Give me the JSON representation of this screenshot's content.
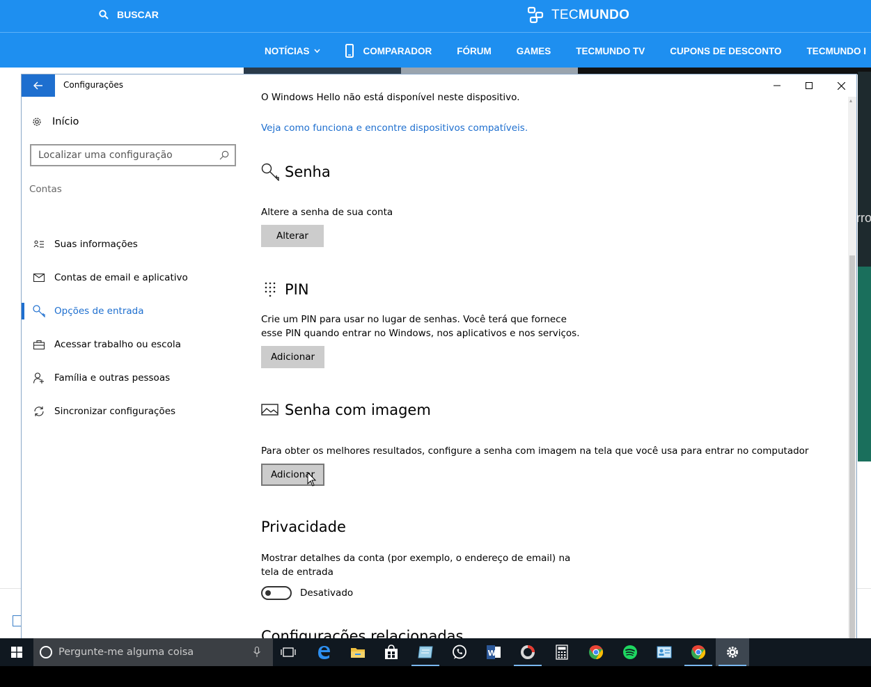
{
  "site": {
    "search_label": "BUSCAR",
    "brand_light": "TEC",
    "brand_bold": "MUNDO",
    "nav": [
      "NOTÍCIAS",
      "COMPARADOR",
      "FÓRUM",
      "GAMES",
      "TECMUNDO TV",
      "CUPONS DE DESCONTO",
      "TECMUNDO I"
    ],
    "bg_text": "rro"
  },
  "window": {
    "title": "Configurações"
  },
  "sidebar": {
    "home_label": "Início",
    "search_placeholder": "Localizar uma configuração",
    "section_label": "Contas",
    "items": [
      {
        "label": "Suas informações",
        "icon": "person-card-icon"
      },
      {
        "label": "Contas de email e aplicativo",
        "icon": "mail-icon"
      },
      {
        "label": "Opções de entrada",
        "icon": "key-icon",
        "active": true
      },
      {
        "label": "Acessar trabalho ou escola",
        "icon": "briefcase-icon"
      },
      {
        "label": "Família e outras pessoas",
        "icon": "person-add-icon"
      },
      {
        "label": "Sincronizar configurações",
        "icon": "sync-icon"
      }
    ]
  },
  "content": {
    "hello_text": "O Windows Hello não está disponível neste dispositivo.",
    "hello_link": "Veja como funciona e encontre dispositivos compatíveis.",
    "password": {
      "heading": "Senha",
      "desc": "Altere a senha de sua conta",
      "button": "Alterar"
    },
    "pin": {
      "heading": "PIN",
      "desc_line1": "Crie um PIN para usar no lugar de senhas. Você terá que fornece",
      "desc_line2": "esse PIN quando entrar no Windows, nos aplicativos e nos serviços.",
      "button": "Adicionar"
    },
    "picture": {
      "heading": "Senha com imagem",
      "desc": "Para obter os melhores resultados, configure a senha com imagem na tela que você usa para entrar no computador",
      "button": "Adicionar"
    },
    "privacy": {
      "heading": "Privacidade",
      "desc_line1": "Mostrar detalhes da conta (por exemplo, o endereço de email) na",
      "desc_line2": "tela de entrada",
      "toggle_state": "Desativado"
    },
    "related_heading": "Configurações relacionadas"
  },
  "taskbar": {
    "search_placeholder": "Pergunte-me alguma coisa"
  },
  "colors": {
    "accent": "#1e6fcf",
    "site_blue": "#1e8ff0",
    "taskbar": "#101820"
  }
}
